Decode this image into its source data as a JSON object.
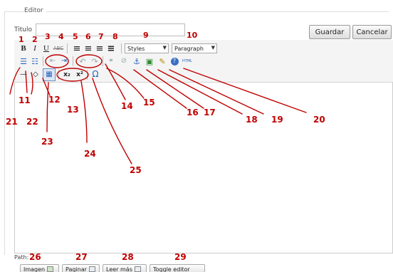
{
  "fieldset": {
    "legend": "Editor"
  },
  "title_field": {
    "label": "Titulo",
    "value": ""
  },
  "actions": {
    "save": "Guardar",
    "cancel": "Cancelar"
  },
  "toolbar": {
    "row1": [
      {
        "name": "bold-button",
        "glyph": "B",
        "icon": "bold-icon"
      },
      {
        "name": "italic-button",
        "glyph": "I",
        "icon": "italic-icon"
      },
      {
        "name": "underline-button",
        "glyph": "U",
        "icon": "underline-icon"
      },
      {
        "name": "strikethrough-button",
        "glyph": "ABC",
        "icon": "strikethrough-icon"
      },
      {
        "name": "align-left-button",
        "glyph": "≡",
        "icon": "align-left-icon"
      },
      {
        "name": "align-center-button",
        "glyph": "≡",
        "icon": "align-center-icon"
      },
      {
        "name": "align-right-button",
        "glyph": "≡",
        "icon": "align-right-icon"
      },
      {
        "name": "align-justify-button",
        "glyph": "≡",
        "icon": "align-justify-icon"
      }
    ],
    "styles_select": "Styles",
    "format_select": "Paragraph",
    "row2": [
      {
        "name": "bullet-list-button",
        "glyph": "☰",
        "icon": "bullet-list-icon"
      },
      {
        "name": "numbered-list-button",
        "glyph": "☷",
        "icon": "numbered-list-icon"
      },
      {
        "name": "outdent-button",
        "glyph": "⇤",
        "icon": "outdent-icon"
      },
      {
        "name": "indent-button",
        "glyph": "⇥",
        "icon": "indent-icon"
      },
      {
        "name": "undo-button",
        "glyph": "↶",
        "icon": "undo-icon"
      },
      {
        "name": "redo-button",
        "glyph": "↷",
        "icon": "redo-icon"
      },
      {
        "name": "link-button",
        "glyph": "⚭",
        "icon": "link-icon"
      },
      {
        "name": "unlink-button",
        "glyph": "⊘",
        "icon": "unlink-icon"
      },
      {
        "name": "anchor-button",
        "glyph": "⚓",
        "icon": "anchor-icon"
      },
      {
        "name": "image-button",
        "glyph": "▣",
        "icon": "image-icon"
      },
      {
        "name": "cleanup-button",
        "glyph": "✎",
        "icon": "cleanup-icon"
      },
      {
        "name": "help-button",
        "glyph": "?",
        "icon": "help-icon"
      },
      {
        "name": "html-button",
        "glyph": "HTML",
        "icon": "html-icon"
      }
    ],
    "row3": [
      {
        "name": "horizontal-rule-button",
        "glyph": "—",
        "icon": "horizontal-rule-icon"
      },
      {
        "name": "remove-format-button",
        "glyph": "◇",
        "icon": "eraser-icon"
      },
      {
        "name": "visual-aid-button",
        "glyph": "▦",
        "icon": "visual-aid-icon"
      },
      {
        "name": "subscript-button",
        "glyph": "x₂",
        "icon": "subscript-icon"
      },
      {
        "name": "superscript-button",
        "glyph": "x²",
        "icon": "superscript-icon"
      },
      {
        "name": "special-char-button",
        "glyph": "Ω",
        "icon": "omega-icon"
      }
    ]
  },
  "callout_numbers": [
    "1",
    "2",
    "3",
    "4",
    "5",
    "6",
    "7",
    "8",
    "9",
    "10",
    "11",
    "12",
    "13",
    "14",
    "15",
    "16",
    "17",
    "18",
    "19",
    "20",
    "21",
    "22",
    "23",
    "24",
    "25",
    "26",
    "27",
    "28",
    "29"
  ],
  "path_label": "Path:",
  "bottom_buttons": [
    {
      "label": "Imagen",
      "icon": "image-icon"
    },
    {
      "label": "Paginar",
      "icon": "pagebreak-icon"
    },
    {
      "label": "Leer más",
      "icon": "readmore-icon"
    },
    {
      "label": "Toggle editor",
      "icon": ""
    }
  ],
  "colors": {
    "annotation": "#c00000",
    "toolbar_bg": "#f4f4f4",
    "border": "#cccccc"
  }
}
